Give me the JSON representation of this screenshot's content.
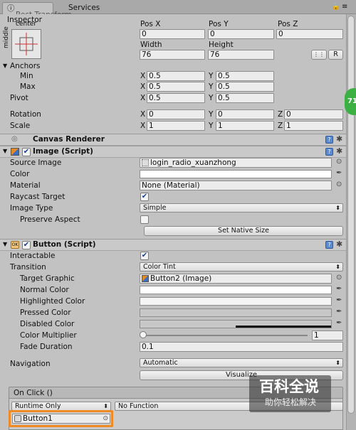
{
  "tabs": {
    "inspector": "Inspector",
    "services": "Services"
  },
  "rect_transform": {
    "title": "Rect Transform",
    "anchor_h": "center",
    "anchor_v": "middle",
    "pos_x_label": "Pos X",
    "pos_y_label": "Pos Y",
    "pos_z_label": "Pos Z",
    "pos_x": "0",
    "pos_y": "0",
    "pos_z": "0",
    "width_label": "Width",
    "height_label": "Height",
    "width": "76",
    "height": "76",
    "r_button": "R",
    "anchors_label": "Anchors",
    "min_label": "Min",
    "max_label": "Max",
    "min_x": "0.5",
    "min_y": "0.5",
    "max_x": "0.5",
    "max_y": "0.5",
    "pivot_label": "Pivot",
    "pivot_x": "0.5",
    "pivot_y": "0.5",
    "rotation_label": "Rotation",
    "rot_x": "0",
    "rot_y": "0",
    "rot_z": "0",
    "scale_label": "Scale",
    "scale_x": "1",
    "scale_y": "1",
    "scale_z": "1",
    "x": "X",
    "y": "Y",
    "z": "Z"
  },
  "side_badge": "71",
  "canvas_renderer": {
    "title": "Canvas Renderer"
  },
  "image": {
    "title": "Image (Script)",
    "source_image_label": "Source Image",
    "source_image": "login_radio_xuanzhong",
    "color_label": "Color",
    "material_label": "Material",
    "material": "None (Material)",
    "raycast_label": "Raycast Target",
    "image_type_label": "Image Type",
    "image_type": "Simple",
    "preserve_label": "Preserve Aspect",
    "set_native": "Set Native Size"
  },
  "button": {
    "title": "Button (Script)",
    "interactable_label": "Interactable",
    "transition_label": "Transition",
    "transition": "Color Tint",
    "target_graphic_label": "Target Graphic",
    "target_graphic": "Button2 (Image)",
    "normal_label": "Normal Color",
    "highlighted_label": "Highlighted Color",
    "pressed_label": "Pressed Color",
    "disabled_label": "Disabled Color",
    "multiplier_label": "Color Multiplier",
    "multiplier": "1",
    "fade_label": "Fade Duration",
    "fade": "0.1",
    "navigation_label": "Navigation",
    "navigation": "Automatic",
    "visualize": "Visualize"
  },
  "on_click": {
    "title": "On Click ()",
    "runtime": "Runtime Only",
    "function": "No Function",
    "object": "Button1"
  },
  "watermark": {
    "title": "百科全说",
    "subtitle": "助你轻松解决"
  },
  "colors": {
    "accent": "#2c5fb4",
    "highlight": "#f08a24",
    "badge": "#3cb043"
  }
}
